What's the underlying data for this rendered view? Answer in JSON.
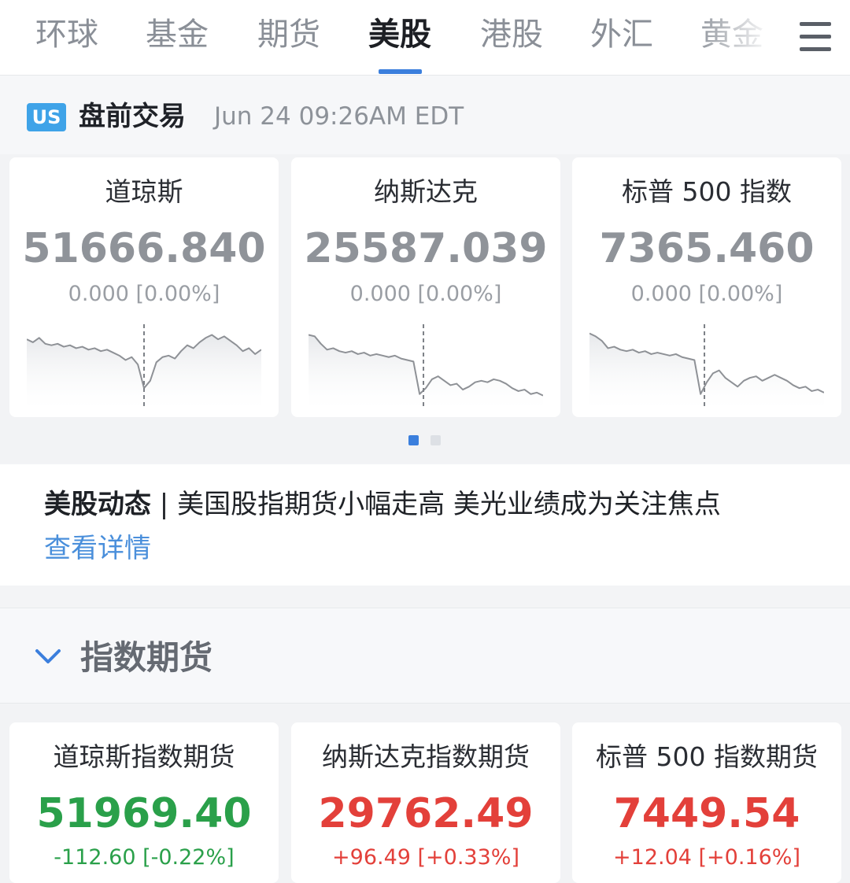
{
  "tabs": [
    {
      "label": "环球",
      "active": false
    },
    {
      "label": "基金",
      "active": false
    },
    {
      "label": "期货",
      "active": false
    },
    {
      "label": "美股",
      "active": true
    },
    {
      "label": "港股",
      "active": false
    },
    {
      "label": "外汇",
      "active": false
    },
    {
      "label": "黄金",
      "active": false
    }
  ],
  "menu_icon": "hamburger-menu-icon",
  "premarket": {
    "badge": "US",
    "label": "盘前交易",
    "time": "Jun 24 09:26AM EDT"
  },
  "indices": [
    {
      "name": "道琼斯",
      "value": "51666.840",
      "change": "0.000 [0.00%]",
      "spark": [
        0.86,
        0.82,
        0.88,
        0.8,
        0.78,
        0.8,
        0.76,
        0.78,
        0.74,
        0.76,
        0.72,
        0.74,
        0.7,
        0.72,
        0.68,
        0.64,
        0.58,
        0.62,
        0.52,
        0.2,
        0.3,
        0.55,
        0.62,
        0.64,
        0.6,
        0.7,
        0.78,
        0.74,
        0.82,
        0.88,
        0.92,
        0.86,
        0.9,
        0.84,
        0.78,
        0.7,
        0.74,
        0.66,
        0.72
      ],
      "break_at": 0.5
    },
    {
      "name": "纳斯达克",
      "value": "25587.039",
      "change": "0.000 [0.00%]",
      "spark": [
        0.92,
        0.9,
        0.8,
        0.72,
        0.74,
        0.7,
        0.68,
        0.7,
        0.66,
        0.68,
        0.64,
        0.66,
        0.64,
        0.62,
        0.64,
        0.6,
        0.58,
        0.56,
        0.12,
        0.2,
        0.32,
        0.36,
        0.3,
        0.24,
        0.26,
        0.18,
        0.22,
        0.28,
        0.3,
        0.28,
        0.32,
        0.3,
        0.26,
        0.2,
        0.16,
        0.18,
        0.12,
        0.14,
        0.1
      ],
      "break_at": 0.49
    },
    {
      "name": "标普 500 指数",
      "value": "7365.460",
      "change": "0.000 [0.00%]",
      "spark": [
        0.94,
        0.9,
        0.84,
        0.74,
        0.76,
        0.72,
        0.7,
        0.72,
        0.68,
        0.7,
        0.66,
        0.68,
        0.66,
        0.64,
        0.66,
        0.62,
        0.6,
        0.58,
        0.12,
        0.28,
        0.4,
        0.44,
        0.34,
        0.28,
        0.22,
        0.3,
        0.34,
        0.36,
        0.3,
        0.34,
        0.38,
        0.34,
        0.3,
        0.24,
        0.2,
        0.22,
        0.16,
        0.18,
        0.14
      ],
      "break_at": 0.49
    }
  ],
  "pager": {
    "count": 2,
    "active": 0
  },
  "news": {
    "tag": "美股动态",
    "separator": " | ",
    "headline": "美国股指期货小幅走高 美光业绩成为关注焦点",
    "link": "查看详情"
  },
  "section": {
    "title": "指数期货",
    "icon": "chevron-down-icon"
  },
  "futures": [
    {
      "name": "道琼斯指数期货",
      "value": "51969.40",
      "change": "-112.60 [-0.22%]",
      "trend": "down"
    },
    {
      "name": "纳斯达克指数期货",
      "value": "29762.49",
      "change": "+96.49 [+0.33%]",
      "trend": "up"
    },
    {
      "name": "标普 500 指数期货",
      "value": "7449.54",
      "change": "+12.04 [+0.16%]",
      "trend": "up"
    }
  ],
  "colors": {
    "accent": "#3b7fdd",
    "up": "#e3403a",
    "down": "#2aa04a",
    "neutral": "#8f9399",
    "link": "#4a8fdb",
    "badge": "#3fa3e8"
  }
}
